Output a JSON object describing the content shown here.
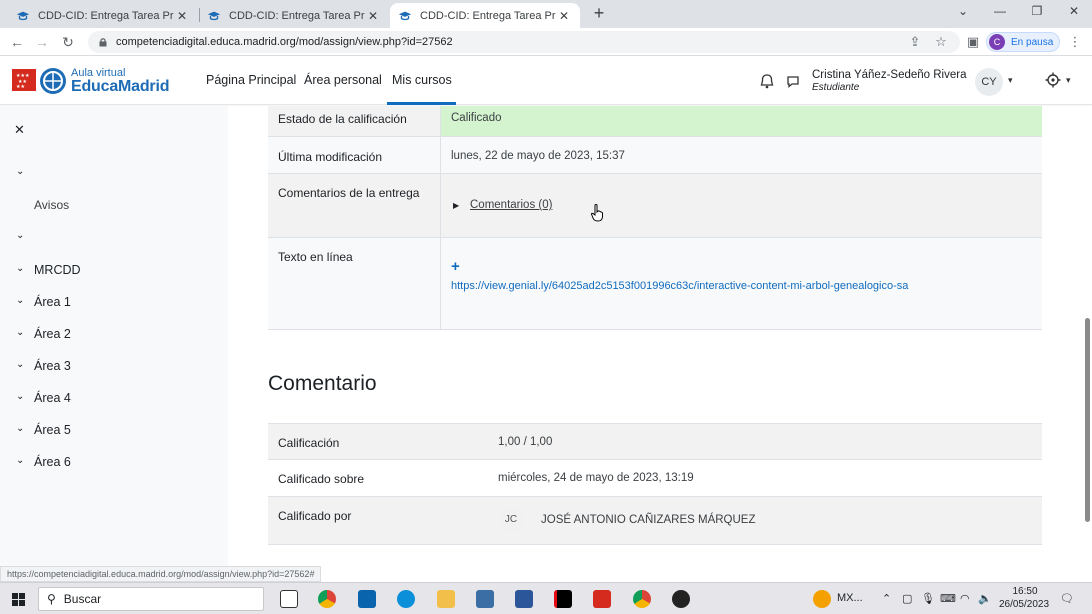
{
  "browser": {
    "tabs": [
      {
        "title": "CDD-CID: Entrega Tarea Práctica"
      },
      {
        "title": "CDD-CID: Entrega Tarea Práctica"
      },
      {
        "title": "CDD-CID: Entrega Tarea Práctica"
      }
    ],
    "new_tab": "+",
    "address": "competenciadigital.educa.madrid.org/mod/assign/view.php?id=27562",
    "profile_initial": "C",
    "profile_label": "En pausa",
    "status_url": "https://competenciadigital.educa.madrid.org/mod/assign/view.php?id=27562#"
  },
  "header": {
    "logo_line1": "Aula virtual",
    "logo_line2": "EducaMadrid",
    "nav": [
      "Página Principal",
      "Área personal",
      "Mis cursos"
    ],
    "user_name": "Cristina Yáñez-Sedeño Rivera",
    "user_role": "Estudiante",
    "user_initials": "CY"
  },
  "drawer": {
    "close": "✕",
    "notice": "Avisos",
    "items": [
      "MRCDD",
      "Área 1",
      "Área 2",
      "Área 3",
      "Área 4",
      "Área 5",
      "Área 6"
    ]
  },
  "submission": {
    "status_label": "Estado de la calificación",
    "status_value": "Calificado",
    "modified_label": "Última modificación",
    "modified_value": "lunes, 22 de mayo de 2023, 15:37",
    "comments_label": "Comentarios de la entrega",
    "comments_link": "Comentarios (0)",
    "online_text_label": "Texto en línea",
    "online_text_url": "https://view.genial.ly/64025ad2c5153f001996c63c/interactive-content-mi-arbol-genealogico-sa"
  },
  "feedback": {
    "title": "Comentario",
    "grade_label": "Calificación",
    "grade_value": "1,00 / 1,00",
    "graded_on_label": "Calificado sobre",
    "graded_on_value": "miércoles, 24 de mayo de 2023, 13:19",
    "graded_by_label": "Calificado por",
    "grader_initials": "JC",
    "grader_name": "JOSÉ ANTONIO CAÑIZARES MÁRQUEZ"
  },
  "taskbar": {
    "search_placeholder": "Buscar",
    "weather": "MX...",
    "time": "16:50",
    "date": "26/05/2023"
  },
  "colors": {
    "accent": "#0f6cbf",
    "graded_bg": "#d4f4cf",
    "brand": "#1e6cb5"
  }
}
